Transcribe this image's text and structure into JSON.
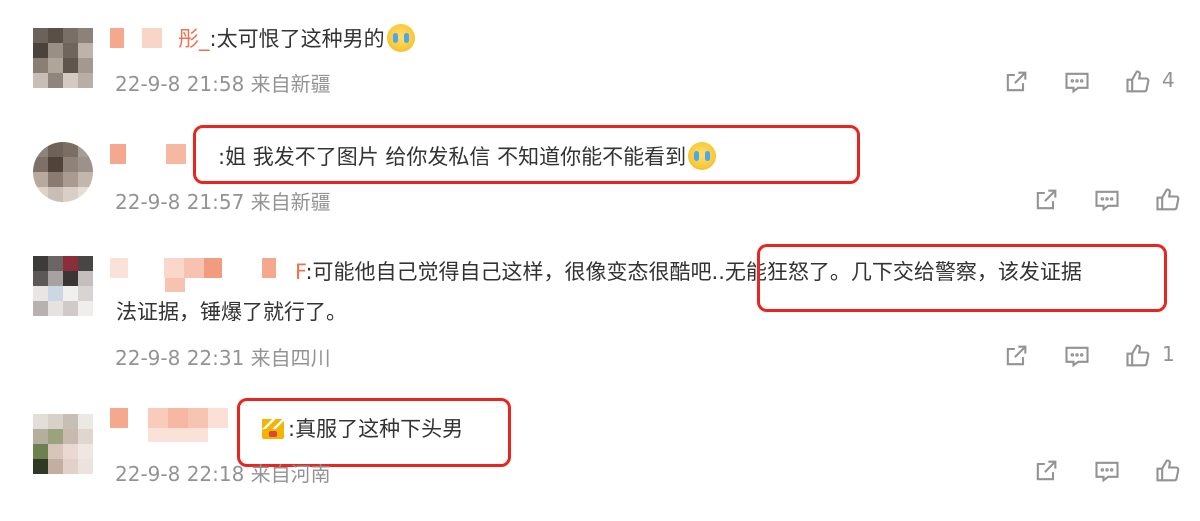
{
  "comments": [
    {
      "name_tail": "彤_",
      "text": ":太可恨了这种男的",
      "meta": "22-9-8 21:58 来自新疆",
      "likes": "4"
    },
    {
      "name_tail": "",
      "text": ":姐 我发不了图片 给你发私信 不知道你能不能看到",
      "meta": "22-9-8 21:57 来自新疆",
      "likes": ""
    },
    {
      "name_tail": "F",
      "text_line1_a": ":可能他自己觉得自己这样，很像变态很酷吧",
      "text_line1_b": "..无能狂怒了。几下交给警察，该发证据",
      "text_line2": "法证据，锤爆了就行了。",
      "meta": "22-9-8 22:31 来自四川",
      "likes": "1"
    },
    {
      "name_tail": "",
      "text": ":真服了这种下头男",
      "meta": "22-9-8 22:18 来自河南",
      "likes": ""
    }
  ],
  "icons": {
    "share": "share-icon",
    "comment": "comment-icon",
    "like": "thumbs-up-icon",
    "emoji_cry": "crying-emoji-icon",
    "crown": "crown-badge-icon"
  },
  "colors": {
    "author": "#eb7350",
    "meta": "#939393",
    "highlight": "#e8251f"
  }
}
